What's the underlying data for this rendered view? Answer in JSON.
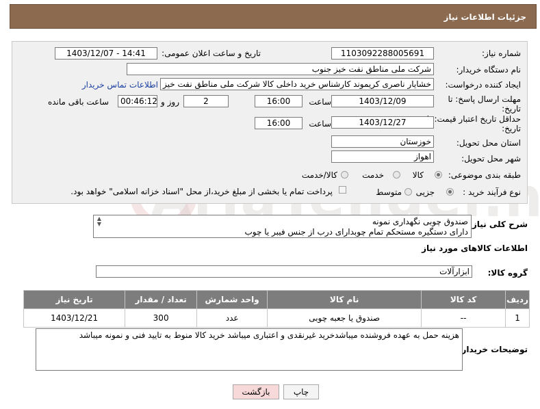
{
  "header": {
    "title": "جزئیات اطلاعات نیاز"
  },
  "form": {
    "need_number_label": "شماره نیاز:",
    "need_number": "1103092288005691",
    "announce_label": "تاریخ و ساعت اعلان عمومی:",
    "announce_value": "1403/12/07 - 14:41",
    "buyer_org_label": "نام دستگاه خریدار:",
    "buyer_org": "شرکت ملی مناطق نفت خیز جنوب",
    "creator_label": "ایجاد کننده درخواست:",
    "creator": "خشایار ناصری کریموند کارشناس خرید داخلی کالا  شرکت ملی مناطق نفت خیز",
    "contact_link": "اطلاعات تماس خریدار",
    "deadline_label_1": "مهلت ارسال پاسخ: تا",
    "deadline_label_2": "تاریخ:",
    "deadline_date": "1403/12/09",
    "time_label": "ساعت",
    "deadline_time": "16:00",
    "days_value": "2",
    "days_label": "روز و",
    "remaining_time": "00:46:12",
    "remaining_label": "ساعت باقی مانده",
    "validity_label_1": "حداقل تاریخ اعتبار قیمت: تا",
    "validity_label_2": "تاریخ:",
    "validity_date": "1403/12/27",
    "validity_time": "16:00",
    "province_label": "استان محل تحویل:",
    "province": "خوزستان",
    "city_label": "شهر محل تحویل:",
    "city": "اهواز",
    "category_label": "طبقه بندی موضوعی:",
    "category_options": [
      "کالا",
      "خدمت",
      "کالا/خدمت"
    ],
    "category_selected": "کالا",
    "process_label": "نوع فرآیند خرید :",
    "process_options": [
      "جزیی",
      "متوسط"
    ],
    "process_selected": "جزیی",
    "payment_note": "پرداخت تمام یا بخشی از مبلغ خرید،از محل \"اسناد خزانه اسلامی\" خواهد بود."
  },
  "description": {
    "label": "شرح کلی نیاز:",
    "line1": "صندوق چوبی  نگهداری نمونه",
    "line2": "دارای دستگیره مستحکم تمام چوبدارای درب  از جنس فیبر یا چوب"
  },
  "goods": {
    "section_title": "اطلاعات کالاهای مورد نیاز",
    "group_label": "گروه کالا:",
    "group_value": "ابزارآلات",
    "columns": [
      "ردیف",
      "کد کالا",
      "نام کالا",
      "واحد شمارش",
      "تعداد / مقدار",
      "تاریخ نیاز"
    ],
    "rows": [
      {
        "index": "1",
        "code": "--",
        "name": "صندوق یا جعبه چوبی",
        "unit": "عدد",
        "qty": "300",
        "date": "1403/12/21"
      }
    ]
  },
  "buyer_notes": {
    "label": "توضیحات خریدار:",
    "text": "هزینه حمل به عهده فروشنده میباشدخرید غیرنقدی و اعتباری میباشد خرید کالا منوط به تایید فنی و نمونه میباشد"
  },
  "buttons": {
    "print": "چاپ",
    "back": "بازگشت"
  },
  "colors": {
    "header_bg": "#8b6a4f",
    "table_header_bg": "#7d7d7d",
    "link": "#1a3fa0",
    "back_button_bg": "#f7d9d9"
  }
}
